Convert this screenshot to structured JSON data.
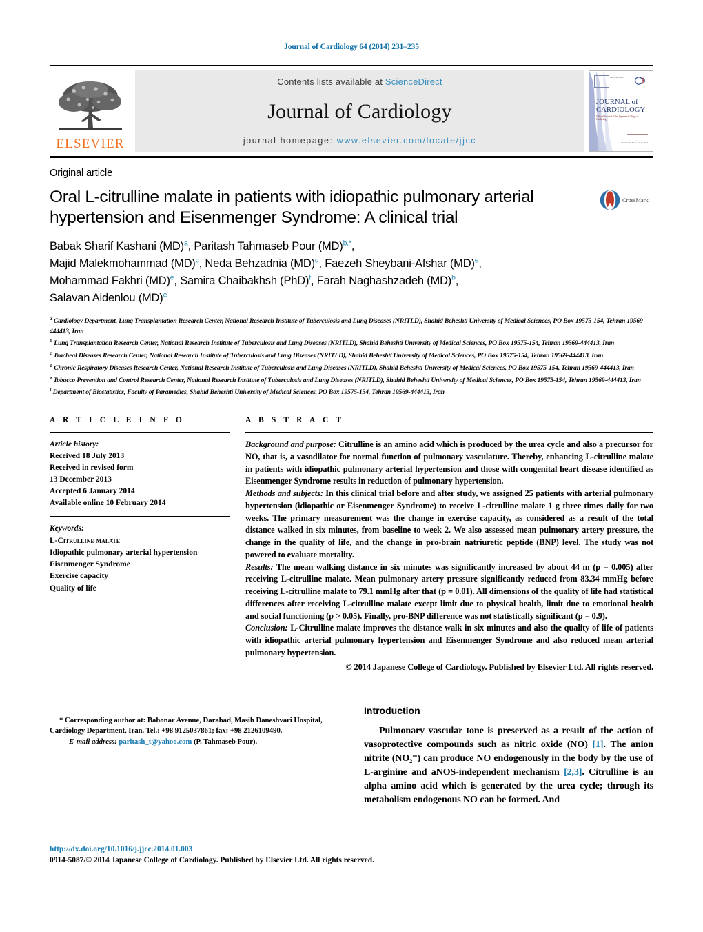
{
  "running_head": "Journal of Cardiology 64 (2014) 231–235",
  "masthead": {
    "publisher_name": "ELSEVIER",
    "contents_prefix": "Contents lists available at ",
    "contents_link": "ScienceDirect",
    "journal_name": "Journal of Cardiology",
    "homepage_prefix": "journal homepage: ",
    "homepage_url": "www.elsevier.com/locate/jjcc",
    "cover": {
      "line1": "JOURNAL of",
      "line2": "CARDIOLOGY",
      "subtitle": "Official Journal of the Japanese College of Cardiology",
      "footer": "Volume 64 Issue 3\nSep 2014"
    },
    "colors": {
      "link": "#3a8fbd",
      "elsevier_orange": "#F37021",
      "band": "#e9e9e9"
    }
  },
  "article": {
    "type": "Original article",
    "title_line1": "Oral L-citrulline malate in patients with idiopathic pulmonary arterial",
    "title_line2": "hypertension and Eisenmenger Syndrome: A clinical trial",
    "crossmark_label": "CrossMark",
    "authors": [
      {
        "name": "Babak Sharif Kashani (MD)",
        "marks": "a",
        "sep": ", "
      },
      {
        "name": "Paritash Tahmaseb Pour (MD)",
        "marks": "b,*",
        "sep": ","
      },
      {
        "name": "Majid Malekmohammad (MD)",
        "marks": "c",
        "sep": ", "
      },
      {
        "name": "Neda Behzadnia (MD)",
        "marks": "d",
        "sep": ", "
      },
      {
        "name": "Faezeh Sheybani-Afshar (MD)",
        "marks": "e",
        "sep": ","
      },
      {
        "name": "Mohammad Fakhri (MD)",
        "marks": "e",
        "sep": ", "
      },
      {
        "name": "Samira Chaibakhsh (PhD)",
        "marks": "f",
        "sep": ", "
      },
      {
        "name": "Farah Naghashzadeh (MD)",
        "marks": "b",
        "sep": ","
      },
      {
        "name": "Salavan Aidenlou (MD)",
        "marks": "e",
        "sep": ""
      }
    ],
    "affiliations": [
      {
        "mark": "a",
        "text": "Cardiology Department, Lung Transplantation Research Center, National Research Institute of Tuberculosis and Lung Diseases (NRITLD), Shahid Beheshti University of Medical Sciences, PO Box 19575-154, Tehran 19569-444413, Iran"
      },
      {
        "mark": "b",
        "text": "Lung Transplantation Research Center, National Research Institute of Tuberculosis and Lung Diseases (NRITLD), Shahid Beheshti University of Medical Sciences, PO Box 19575-154, Tehran 19569-444413, Iran"
      },
      {
        "mark": "c",
        "text": "Tracheal Diseases Research Center, National Research Institute of Tuberculosis and Lung Diseases (NRITLD), Shahid Beheshti University of Medical Sciences, PO Box 19575-154, Tehran 19569-444413, Iran"
      },
      {
        "mark": "d",
        "text": "Chronic Respiratory Diseases Research Center, National Research Institute of Tuberculosis and Lung Diseases (NRITLD), Shahid Beheshti University of Medical Sciences, PO Box 19575-154, Tehran 19569-444413, Iran"
      },
      {
        "mark": "e",
        "text": "Tobacco Prevention and Control Research Center, National Research Institute of Tuberculosis and Lung Diseases (NRITLD), Shahid Beheshti University of Medical Sciences, PO Box 19575-154, Tehran 19569-444413, Iran"
      },
      {
        "mark": "f",
        "text": "Department of Biostatistics, Faculty of Paramedics, Shahid Beheshti University of Medical Sciences, PO Box 19575-154, Tehran 19569-444413, Iran"
      }
    ]
  },
  "article_info": {
    "heading": "A R T I C L E   I N F O",
    "history_heading": "Article history:",
    "history": [
      "Received 18 July 2013",
      "Received in revised form",
      "13 December 2013",
      "Accepted 6 January 2014",
      "Available online 10 February 2014"
    ],
    "keywords_heading": "Keywords:",
    "keywords": [
      "L-Citrulline malate",
      "Idiopathic pulmonary arterial hypertension",
      "Eisenmenger Syndrome",
      "Exercise capacity",
      "Quality of life"
    ]
  },
  "abstract": {
    "heading": "A B S T R A C T",
    "paragraphs": [
      {
        "lead": "Background and purpose:",
        "text": " Citrulline is an amino acid which is produced by the urea cycle and also a precursor for NO, that is, a vasodilator for normal function of pulmonary vasculature. Thereby, enhancing L-citrulline malate in patients with idiopathic pulmonary arterial hypertension and those with congenital heart disease identified as Eisenmenger Syndrome results in reduction of pulmonary hypertension."
      },
      {
        "lead": "Methods and subjects:",
        "text": " In this clinical trial before and after study, we assigned 25 patients with arterial pulmonary hypertension (idiopathic or Eisenmenger Syndrome) to receive L-citrulline malate 1 g three times daily for two weeks. The primary measurement was the change in exercise capacity, as considered as a result of the total distance walked in six minutes, from baseline to week 2. We also assessed mean pulmonary artery pressure, the change in the quality of life, and the change in pro-brain natriuretic peptide (BNP) level. The study was not powered to evaluate mortality."
      },
      {
        "lead": "Results:",
        "text": " The mean walking distance in six minutes was significantly increased by about 44 m (p = 0.005) after receiving L-citrulline malate. Mean pulmonary artery pressure significantly reduced from 83.34 mmHg before receiving L-citrulline malate to 79.1 mmHg after that (p = 0.01). All dimensions of the quality of life had statistical differences after receiving L-citrulline malate except limit due to physical health, limit due to emotional health and social functioning (p > 0.05). Finally, pro-BNP difference was not statistically significant (p = 0.9)."
      },
      {
        "lead": "Conclusion:",
        "text": " L-Citrulline malate improves the distance walk in six minutes and also the quality of life of patients with idiopathic arterial pulmonary hypertension and Eisenmenger Syndrome and also reduced mean arterial pulmonary hypertension."
      }
    ],
    "copyright": "© 2014 Japanese College of Cardiology. Published by Elsevier Ltd. All rights reserved."
  },
  "body": {
    "intro_heading": "Introduction",
    "intro_text_1": "Pulmonary vascular tone is preserved as a result of the action of vasoprotective compounds such as nitric oxide (NO) ",
    "ref1": "[1]",
    "intro_text_2": ". The anion nitrite (NO₂⁻) can produce NO endogenously in the body by the use of L-arginine and aNOS-independent mechanism ",
    "ref2": "[2,3]",
    "intro_text_3": ". Citrulline is an alpha amino acid which is generated by the urea cycle; through its metabolism endogenous NO can be formed. And"
  },
  "footnotes": {
    "corr_line1": "* Corresponding author at: Bahonar Avenue, Darabad, Masih Daneshvari Hospital,",
    "corr_line2": "Cardiology Department, Iran. Tel.: +98 9125037861; fax: +98 2126109490.",
    "email_label": "E-mail address:",
    "email": "paritash_t@yahoo.com",
    "email_owner": "(P. Tahmaseb Pour).",
    "doi": "http://dx.doi.org/10.1016/j.jjcc.2014.01.003",
    "issn_line": "0914-5087/© 2014 Japanese College of Cardiology. Published by Elsevier Ltd. All rights reserved."
  }
}
